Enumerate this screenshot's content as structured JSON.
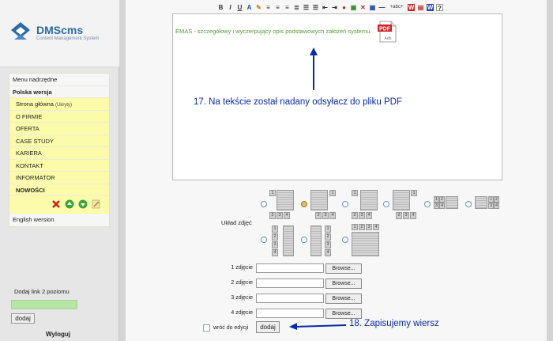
{
  "app": {
    "logo_name": "DMScms",
    "logo_sub": "Content Management System"
  },
  "sidebar": {
    "menu_parent": "Menu nadrzędne",
    "polish_version": "Polska wersja",
    "items": [
      {
        "label": "Strona główna",
        "note": "(Ukryty)"
      },
      {
        "label": "O FIRMIE"
      },
      {
        "label": "OFERTA"
      },
      {
        "label": "CASE STUDY"
      },
      {
        "label": "KARIERA"
      },
      {
        "label": "KONTAKT"
      },
      {
        "label": "INFORMATOR"
      },
      {
        "label": "NOWOŚCI"
      }
    ],
    "english_version": "English wersion",
    "add_link_label": "Dodaj link 2 poziomu",
    "add_link_value": "",
    "add_button": "dodaj",
    "logout": "Wyloguj"
  },
  "toolbar": {
    "bold": "B",
    "italic": "I",
    "underline": "U",
    "font_color": "A",
    "insert_text_label": "+abc+"
  },
  "editor": {
    "content": "EMAS - szczegółowy i wyczerpujący opis podstawowych założeń systemu.",
    "pdf_icon_label": "PDF"
  },
  "annotations": {
    "note17": "17. Na tekście został nadany odsyłacz do pliku PDF",
    "note18": "18. Zapisujemy wiersz"
  },
  "layout_section": {
    "label": "Układ zdjęć",
    "selected_index": 1
  },
  "photos": {
    "rows": [
      {
        "label": "1 zdjęcie",
        "button": "Browse..."
      },
      {
        "label": "2 zdjęcie",
        "button": "Browse..."
      },
      {
        "label": "3 zdjęcie",
        "button": "Browse..."
      },
      {
        "label": "4 zdjęcie",
        "button": "Browse..."
      }
    ]
  },
  "footer": {
    "back_label": "wróć do edycji",
    "save_button": "dodaj"
  },
  "colors": {
    "accent_blue": "#0a2aa8",
    "menu_yellow": "#fbfbaa",
    "editor_text_green": "#5a9a3a"
  }
}
